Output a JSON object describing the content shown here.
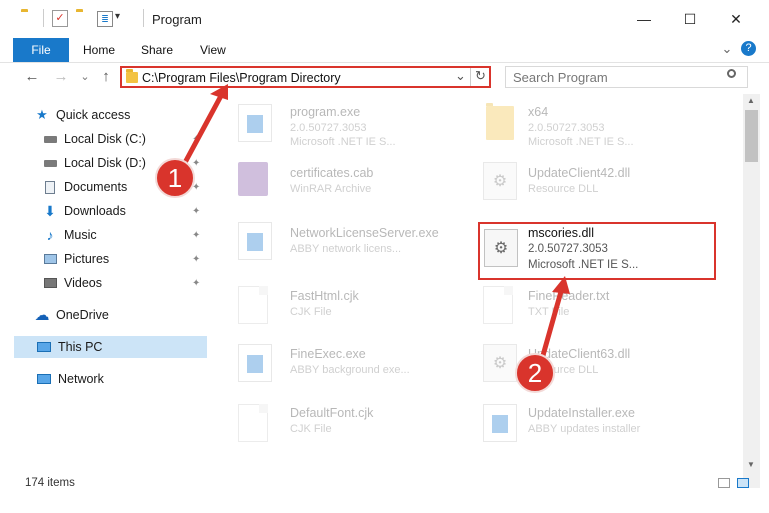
{
  "window": {
    "title": "Program",
    "minimize": "—",
    "maximize": "☐",
    "close": "✕"
  },
  "ribbon": {
    "file": "File",
    "home": "Home",
    "share": "Share",
    "view": "View",
    "expand": "⌄",
    "help": "?"
  },
  "address": {
    "path": "C:\\Program Files\\Program Directory",
    "dropdown": "⌄",
    "refresh": "↻"
  },
  "search": {
    "placeholder": "Search Program"
  },
  "nav": {
    "back": "←",
    "forward": "→",
    "recent": "⌄",
    "up": "↑",
    "items": [
      {
        "label": "Quick access",
        "icon": "star-icon"
      },
      {
        "label": "Local Disk (C:)",
        "icon": "drive-icon"
      },
      {
        "label": "Local Disk (D:)",
        "icon": "drive-icon"
      },
      {
        "label": "Documents",
        "icon": "documents-icon"
      },
      {
        "label": "Downloads",
        "icon": "download-icon"
      },
      {
        "label": "Music",
        "icon": "music-icon"
      },
      {
        "label": "Pictures",
        "icon": "pictures-icon"
      },
      {
        "label": "Videos",
        "icon": "videos-icon"
      },
      {
        "label": "OneDrive",
        "icon": "cloud-icon"
      },
      {
        "label": "This PC",
        "icon": "computer-icon"
      },
      {
        "label": "Network",
        "icon": "network-icon"
      }
    ]
  },
  "files": [
    {
      "name": "program.exe",
      "l2": "2.0.50727.3053",
      "l3": "Microsoft .NET IE S..."
    },
    {
      "name": "x64",
      "l2": "2.0.50727.3053",
      "l3": "Microsoft .NET IE S..."
    },
    {
      "name": "certificates.cab",
      "l2": "WinRAR Archive",
      "l3": ""
    },
    {
      "name": "UpdateClient42.dll",
      "l2": "Resource DLL",
      "l3": ""
    },
    {
      "name": "NetworkLicenseServer.exe",
      "l2": "ABBY network licens...",
      "l3": ""
    },
    {
      "name": "mscories.dll",
      "l2": "2.0.50727.3053",
      "l3": "Microsoft .NET IE S..."
    },
    {
      "name": "FastHtml.cjk",
      "l2": "CJK File",
      "l3": ""
    },
    {
      "name": "FineReader.txt",
      "l2": "TXT File",
      "l3": ""
    },
    {
      "name": "FineExec.exe",
      "l2": "ABBY background exe...",
      "l3": ""
    },
    {
      "name": "UpdateClient63.dll",
      "l2": "Resource DLL",
      "l3": ""
    },
    {
      "name": "DefaultFont.cjk",
      "l2": "CJK File",
      "l3": ""
    },
    {
      "name": "UpdateInstaller.exe",
      "l2": "ABBY updates installer",
      "l3": ""
    }
  ],
  "status": {
    "count": "174 items"
  },
  "annotations": {
    "step1": "1",
    "step2": "2"
  },
  "colors": {
    "accent": "#1979ca",
    "highlight": "#d9342c",
    "selection": "#cce4f7"
  }
}
